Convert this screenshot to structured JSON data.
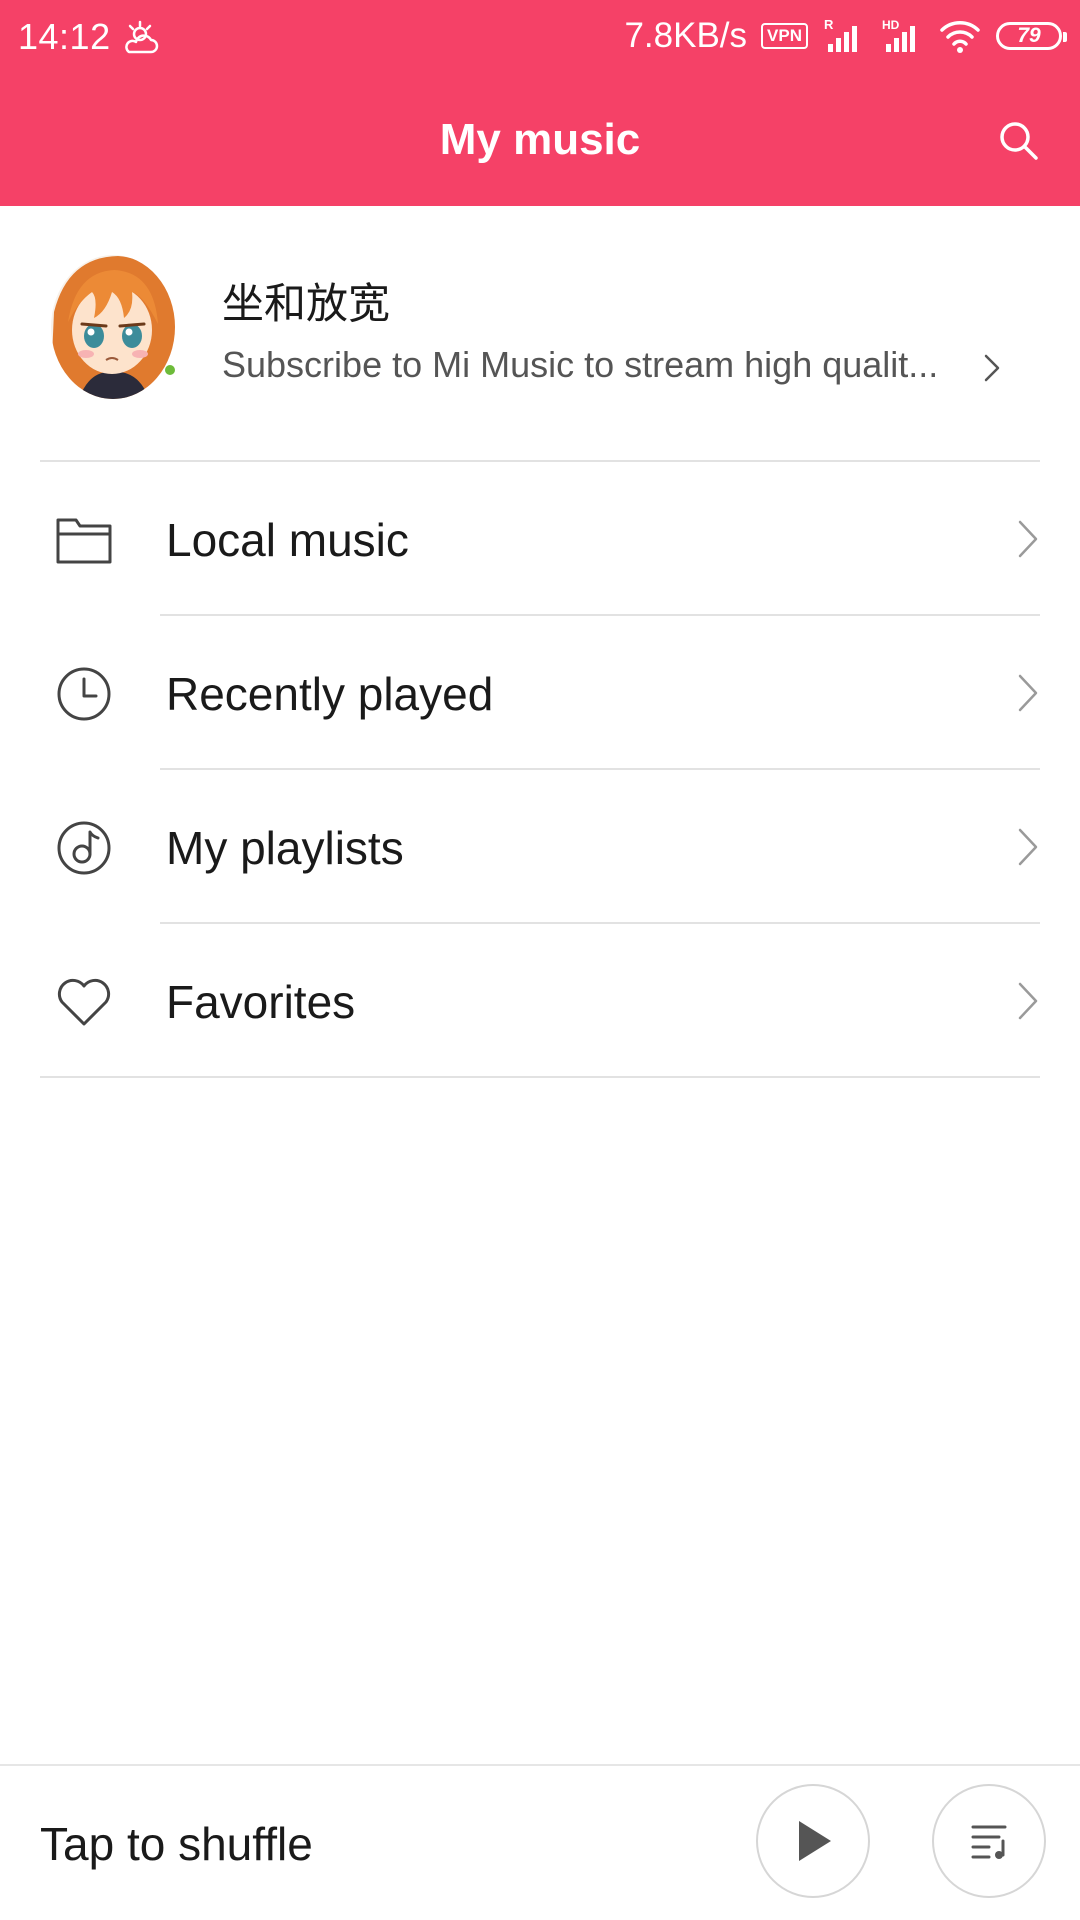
{
  "status_bar": {
    "time": "14:12",
    "weather_icon": "partly-cloudy-icon",
    "net_speed": "7.8KB/s",
    "vpn_label": "VPN",
    "signal_1_label": "R",
    "signal_2_label": "HD",
    "battery_level": "79"
  },
  "header": {
    "title": "My music",
    "search_icon": "search-icon"
  },
  "profile": {
    "name": "坐和放宽",
    "subtitle": "Subscribe to Mi Music to stream high qualit..."
  },
  "menu": {
    "items": [
      {
        "label": "Local music",
        "icon": "folder-icon"
      },
      {
        "label": "Recently played",
        "icon": "clock-icon"
      },
      {
        "label": "My playlists",
        "icon": "music-disc-icon"
      },
      {
        "label": "Favorites",
        "icon": "heart-icon"
      }
    ]
  },
  "player": {
    "shuffle_label": "Tap to shuffle",
    "play_icon": "play-icon",
    "queue_icon": "playlist-queue-icon"
  },
  "colors": {
    "accent": "#f54167",
    "text_primary": "#1a1a1a",
    "text_secondary": "#555555",
    "divider": "#e2e2e2",
    "icon": "#444444"
  }
}
